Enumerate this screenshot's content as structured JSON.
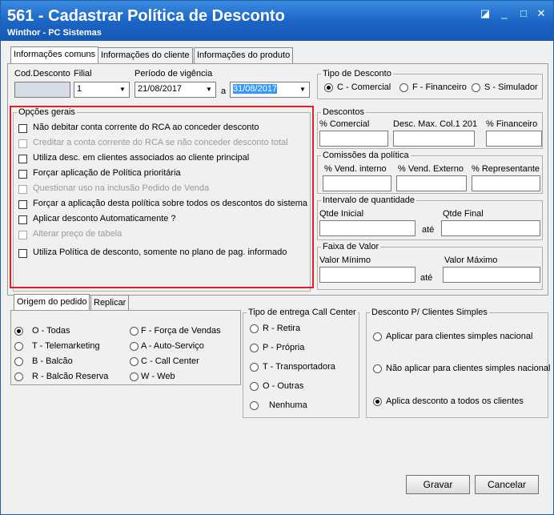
{
  "window": {
    "title": "561 - Cadastrar Política de Desconto",
    "subtitle": "Winthor - PC Sistemas",
    "controls": {
      "restore": "◪",
      "minimize": "_",
      "maximize": "□",
      "close": "✕"
    }
  },
  "tabs": [
    "Informações comuns",
    "Informações do cliente",
    "Informações do produto"
  ],
  "fields": {
    "cod_desconto_label": "Cod.Desconto",
    "filial_label": "Filial",
    "filial_value": "1",
    "periodo_label": "Período de vigência",
    "data_inicio": "21/08/2017",
    "data_a": "a",
    "data_fim": "31/08/2017"
  },
  "tipo_desconto": {
    "title": "Tipo de Desconto",
    "options": [
      "C - Comercial",
      "F - Financeiro",
      "S - Simulador"
    ],
    "selected": 0
  },
  "opcoes_gerais": {
    "title": "Opções gerais",
    "items": [
      {
        "label": "Não debitar conta corrente do RCA ao conceder desconto",
        "enabled": true
      },
      {
        "label": "Creditar a conta corrente do RCA se não conceder desconto total",
        "enabled": false
      },
      {
        "label": "Utiliza desc. em clientes associados ao cliente principal",
        "enabled": true
      },
      {
        "label": "Forçar aplicação de Política prioritária",
        "enabled": true
      },
      {
        "label": "Questionar uso na inclusão Pedido de Venda",
        "enabled": false
      },
      {
        "label": "Forçar a aplicação desta política sobre todos os descontos do sistema",
        "enabled": true
      },
      {
        "label": "Aplicar desconto Automaticamente ?",
        "enabled": true
      },
      {
        "label": "Alterar preço de tabela",
        "enabled": false
      },
      {
        "label": "Utiliza Política de desconto, somente no plano de pag. informado",
        "enabled": true
      }
    ]
  },
  "descontos": {
    "title": "Descontos",
    "labels": [
      "% Comercial",
      "Desc. Max. Col.1 201",
      "% Financeiro"
    ]
  },
  "comissoes": {
    "title": "Comissões da política",
    "labels": [
      "% Vend. interno",
      "% Vend. Externo",
      "% Representante"
    ]
  },
  "intervalo": {
    "title": "Intervalo de quantidade",
    "inicial": "Qtde Inicial",
    "final": "Qtde Final",
    "ate": "até"
  },
  "faixa": {
    "title": "Faixa de Valor",
    "minimo": "Valor Mínimo",
    "maximo": "Valor Máximo",
    "ate": "até"
  },
  "bottom_tabs": [
    "Origem do pedido",
    "Replicar"
  ],
  "origem": {
    "options": [
      "O - Todas",
      "T - Telemarketing",
      "B - Balcão",
      "R - Balcão Reserva",
      "F - Força de Vendas",
      "A - Auto-Serviço",
      "C - Call Center",
      "W - Web"
    ],
    "selected": 0
  },
  "entrega": {
    "title": "Tipo de entrega Call Center",
    "options": [
      "R - Retira",
      "P - Própria",
      "T - Transportadora",
      "O - Outras",
      "Nenhuma"
    ]
  },
  "clientes_simples": {
    "title": "Desconto P/ Clientes Simples",
    "options": [
      "Aplicar para clientes simples nacional",
      "Não aplicar para clientes simples nacional",
      "Aplica desconto a todos os clientes"
    ],
    "selected": 2
  },
  "buttons": {
    "gravar": "Gravar",
    "cancelar": "Cancelar"
  },
  "colors": {
    "title_bar": "#1a64c4",
    "highlight": "#e0202a",
    "selected_date": "#3399ff"
  }
}
